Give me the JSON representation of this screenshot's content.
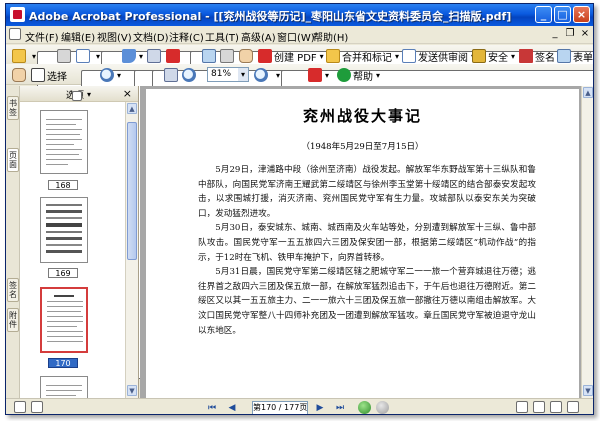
{
  "window": {
    "title": "Adobe Acrobat Professional - [[兖州战役等历记]_枣阳山东省文史资料委员会_扫描版.pdf]",
    "minimize_label": "_",
    "maximize_label": "□",
    "close_label": "×"
  },
  "menubar": {
    "items": [
      "文件(F)",
      "编辑(E)",
      "视图(V)",
      "文档(D)",
      "注释(C)",
      "工具(T)",
      "高级(A)",
      "窗口(W)",
      "帮助(H)"
    ],
    "right_icons": [
      "minimize-doc-icon",
      "restore-doc-icon",
      "close-doc-icon"
    ]
  },
  "toolbar1": {
    "create_pdf_label": "创建 PDF",
    "combine_label": "合并和标记",
    "send_review_label": "发送供审阅",
    "secure_label": "安全",
    "sign_label": "签名",
    "forms_label": "表单"
  },
  "toolbar2": {
    "select_label": "选择",
    "zoom_value": "81%",
    "help_label": "帮助"
  },
  "side_tabs": [
    "书签",
    "页面",
    "签名",
    "附件"
  ],
  "thumbnail_panel": {
    "options_label": "选项",
    "close_label": "×",
    "pages": [
      {
        "label": "168",
        "active": false
      },
      {
        "label": "169",
        "active": false
      },
      {
        "label": "170",
        "active": true
      }
    ]
  },
  "document": {
    "title": "兖州战役大事记",
    "subtitle": "（1948年5月29日至7月15日）",
    "paragraphs": [
      "5月29日，津浦路中段（徐州至济南）战役发起。解放军华东野战军第十三纵队和鲁中部队，向国民党军济南王耀武第二绥靖区与徐州李玉堂第十绥靖区的结合部泰安发起攻击，以求围城打援，消灭济南、兖州国民党守军有生力量。攻城部队以泰安东关为突破口，发动猛烈进攻。",
      "5月30日，泰安城东、城南、城西南及火车站等处，分别遭到解放军十三纵、鲁中部队攻击。国民党守军一五五旅四六三团及保安团一部，根据第二绥靖区“机动作战”的指示，于12时在飞机、铁甲车掩护下，向界首转移。",
      "5月31日晨，国民党守军第二绥靖区辖之肥城守军二一一旅一个营弃城退往万德；逃往界首之敌四六三团及保五旅一部，在解放军猛烈追击下，于午后也退往万德附近。第二绥区又以其一五五旅主力、二一一旅六十三团及保五旅一部撤往万德以南组击解放军。大汶口国民党守军整八十四师补充团及一团遭到解放军猛攻。章丘国民党守军被迫退守龙山以东地区。"
    ]
  },
  "statusbar": {
    "page_indicator": "第170 / 177页"
  }
}
